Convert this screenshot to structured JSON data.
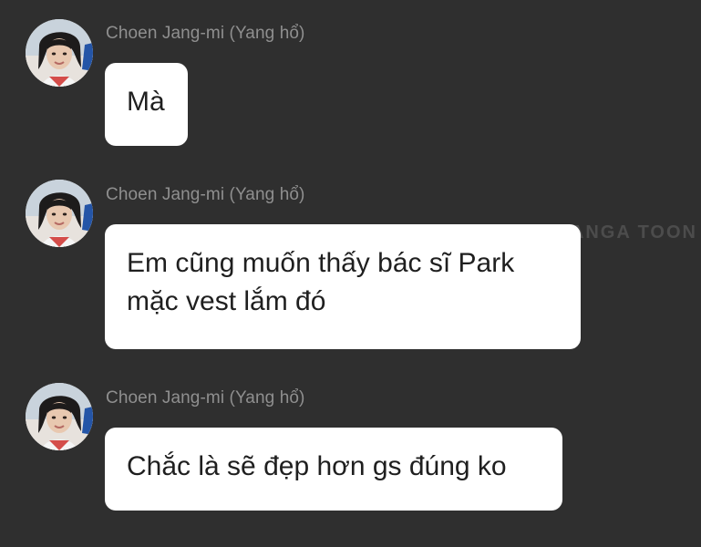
{
  "chat": {
    "messages": [
      {
        "sender": "Choen Jang-mi (Yang hổ)",
        "lines": [
          "Mà"
        ]
      },
      {
        "sender": "Choen Jang-mi (Yang hổ)",
        "lines": [
          "Em cũng muốn thấy bác sĩ Park",
          "mặc vest lắm đó"
        ]
      },
      {
        "sender": "Choen Jang-mi (Yang hổ)",
        "lines": [
          "Chắc là sẽ đẹp hơn gs đúng ko"
        ]
      }
    ],
    "avatar_icon": "user-avatar-photo-icon"
  },
  "watermark": "MANGA TOON"
}
